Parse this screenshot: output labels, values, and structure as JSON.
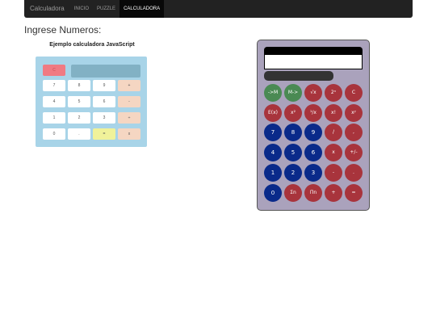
{
  "navbar": {
    "brand": "Calculadora",
    "items": [
      {
        "label": "INICIO",
        "active": false
      },
      {
        "label": "PUZZLE",
        "active": false
      },
      {
        "label": "CALCULADORA",
        "active": true
      }
    ]
  },
  "page": {
    "title": "Ingrese Numeros:"
  },
  "small_calculator": {
    "title": "Ejemplo calculadora JavaScript",
    "clear_label": "C",
    "rows": [
      [
        "7",
        "8",
        "9",
        "+"
      ],
      [
        "4",
        "5",
        "6",
        "-"
      ],
      [
        "1",
        "2",
        "3",
        "÷"
      ],
      [
        "0",
        ".",
        "=",
        "x"
      ]
    ]
  },
  "big_calculator": {
    "rows": [
      [
        "->M",
        "M->",
        "√x",
        "2ⁿ",
        "C"
      ],
      [
        "E(x)",
        "x²",
        "¹/x",
        "x!",
        "xʸ"
      ],
      [
        "7",
        "8",
        "9",
        "/",
        ","
      ],
      [
        "4",
        "5",
        "6",
        "x",
        "+/-"
      ],
      [
        "1",
        "2",
        "3",
        "-",
        "."
      ],
      [
        "0",
        "Σn",
        "Πn",
        "+",
        "="
      ]
    ]
  },
  "colors": {
    "navbar": "#222222",
    "small_calc_bg": "#a8d4e8",
    "big_calc_bg": "#aaa2bc",
    "btn_green": "#4a8a53",
    "btn_red": "#a8343c",
    "btn_blue": "#0a2a8a"
  }
}
